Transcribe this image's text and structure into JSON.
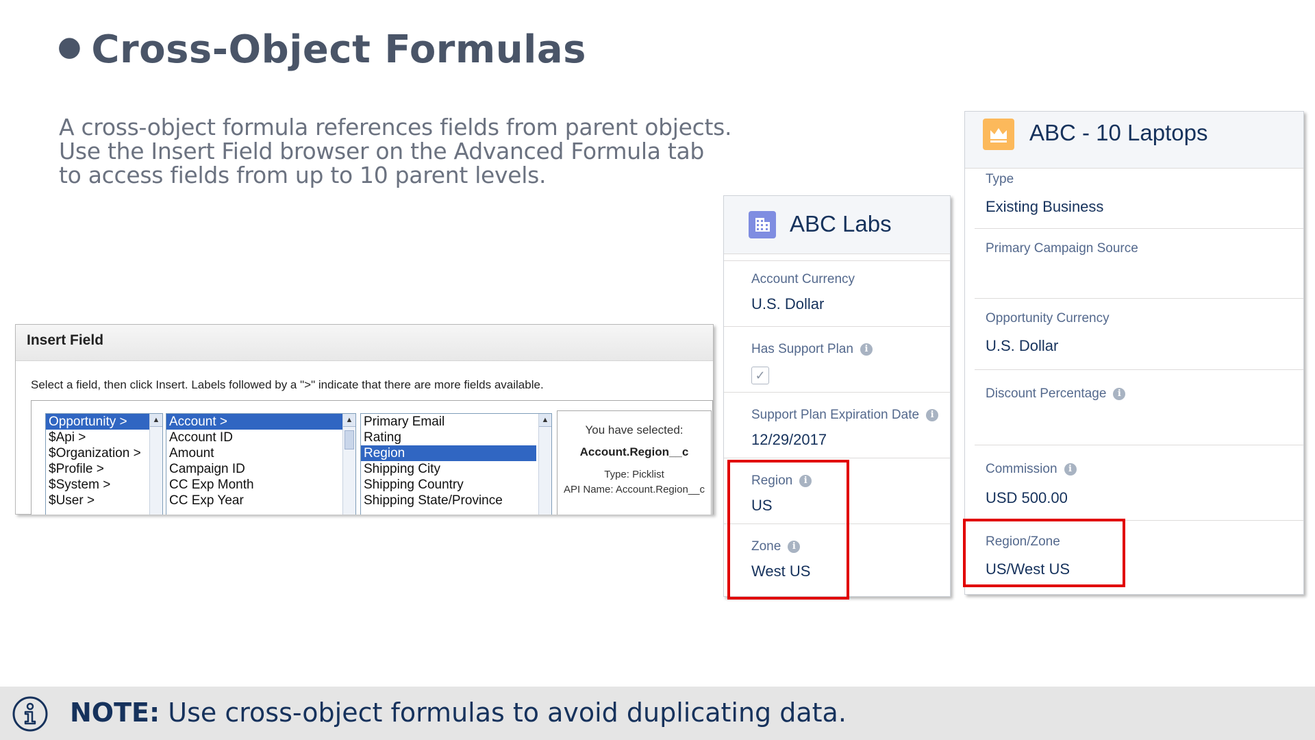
{
  "slide": {
    "title": "Cross-Object Formulas",
    "intro_lines": [
      "A cross-object formula references fields from parent objects.",
      "Use the Insert Field browser on the Advanced Formula tab",
      "to access fields from up to 10 parent levels."
    ]
  },
  "insert_field": {
    "title": "Insert Field",
    "help": "Select a field, then click Insert. Labels followed by a \">\" indicate that there are more fields available.",
    "list1": [
      "Opportunity >",
      "$Api >",
      "$Organization >",
      "$Profile >",
      "$System >",
      "$User >"
    ],
    "list2": [
      "Account >",
      "Account ID",
      "Amount",
      "Campaign ID",
      "CC Exp Month",
      "CC Exp Year"
    ],
    "list3": [
      "Primary Email",
      "Rating",
      "Region",
      "Shipping City",
      "Shipping Country",
      "Shipping State/Province"
    ],
    "selected": {
      "heading": "You have selected:",
      "field": "Account.Region__c",
      "type": "Type: Picklist",
      "api": "API Name: Account.Region__c"
    }
  },
  "account_card": {
    "title": "ABC Labs",
    "icon": "building-icon",
    "icon_color": "#7f8de1",
    "fields": [
      {
        "label": "Account Currency",
        "value": "U.S. Dollar"
      },
      {
        "label": "Has Support Plan",
        "value": "checked"
      },
      {
        "label": "Support Plan Expiration Date",
        "value": "12/29/2017"
      },
      {
        "label": "Region",
        "value": "US"
      },
      {
        "label": "Zone",
        "value": "West US"
      }
    ]
  },
  "opportunity_card": {
    "title": "ABC - 10 Laptops",
    "icon": "crown-icon",
    "icon_color": "#fcb95b",
    "fields": [
      {
        "label": "Type",
        "value": "Existing Business"
      },
      {
        "label": "Primary Campaign Source",
        "value": ""
      },
      {
        "label": "Opportunity Currency",
        "value": "U.S. Dollar"
      },
      {
        "label": "Discount Percentage",
        "value": ""
      },
      {
        "label": "Commission",
        "value": "USD 500.00"
      },
      {
        "label": "Region/Zone",
        "value": "US/West US"
      }
    ]
  },
  "highlight_color": "#e10000",
  "note": {
    "label": "NOTE:",
    "text": "Use cross-object formulas to avoid duplicating data.",
    "icon": "info-icon"
  }
}
